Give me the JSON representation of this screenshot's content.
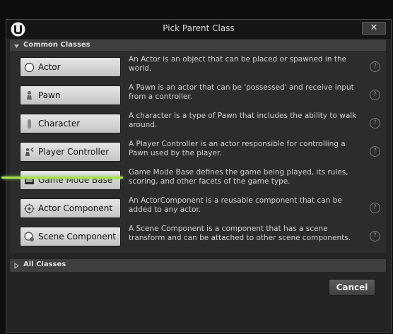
{
  "window": {
    "title": "Pick Parent Class",
    "close_label": "✕"
  },
  "common_section": {
    "header": "Common Classes",
    "items": [
      {
        "label": "Actor",
        "icon": "actor-sphere-icon",
        "description": "An Actor is an object that can be placed or spawned in the world."
      },
      {
        "label": "Pawn",
        "icon": "pawn-icon",
        "description": "A Pawn is an actor that can be 'possessed' and receive input from a controller."
      },
      {
        "label": "Character",
        "icon": "character-icon",
        "description": "A character is a type of Pawn that includes the ability to walk around."
      },
      {
        "label": "Player Controller",
        "icon": "player-controller-icon",
        "description": "A Player Controller is an actor responsible for controlling a Pawn used by the player."
      },
      {
        "label": "Game Mode Base",
        "icon": "game-mode-icon",
        "description": "Game Mode Base defines the game being played, its rules, scoring, and other facets of the game type."
      },
      {
        "label": "Actor Component",
        "icon": "actor-component-icon",
        "description": "An ActorComponent is a reusable component that can be added to any actor."
      },
      {
        "label": "Scene Component",
        "icon": "scene-component-icon",
        "description": "A Scene Component is a component that has a scene transform and can be attached to other scene components."
      }
    ]
  },
  "all_section": {
    "header": "All Classes"
  },
  "footer": {
    "cancel_label": "Cancel"
  },
  "colors": {
    "highlight": "#a8e05a"
  }
}
